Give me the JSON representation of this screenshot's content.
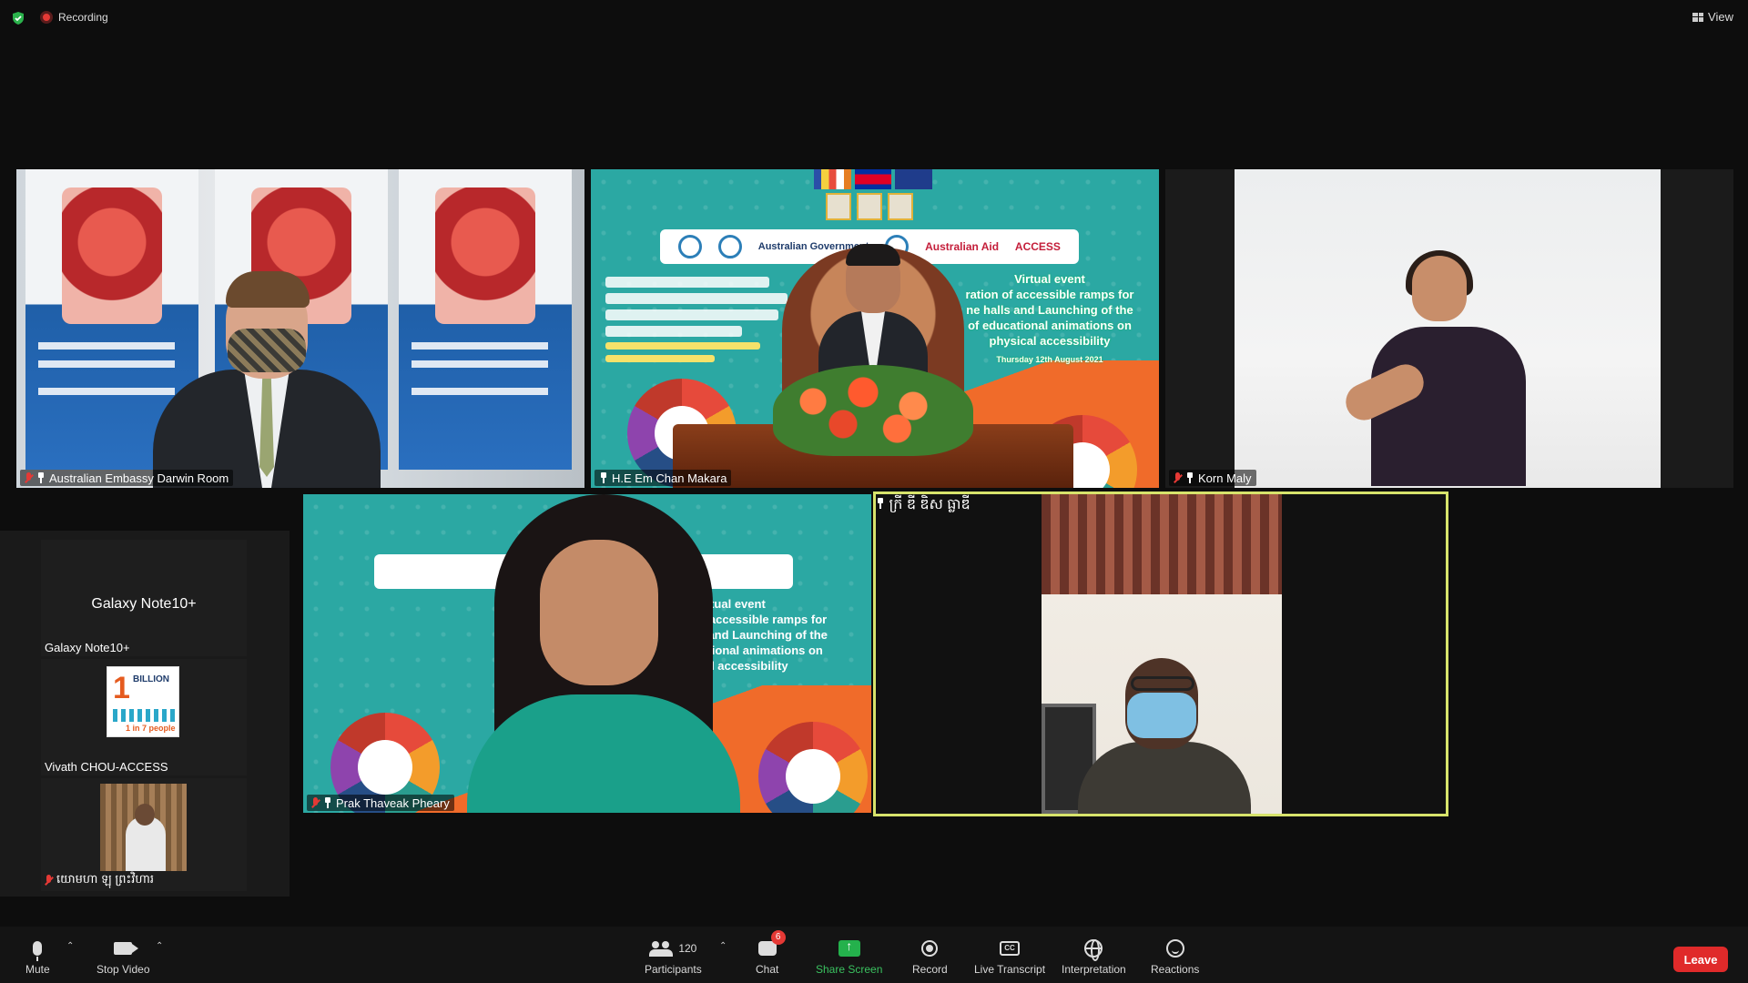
{
  "topbar": {
    "recording_label": "Recording",
    "view_label": "View"
  },
  "tiles": {
    "embassy": {
      "name": "Australian Embassy Darwin Room"
    },
    "minister": {
      "name": "H.E Em Chan Makara",
      "event_title": "Virtual event",
      "event_line1": "ration of accessible ramps for",
      "event_line2": "ne halls and Launching of the",
      "event_line3": "of educational animations on",
      "event_line4": "physical accessibility",
      "event_date": "Thursday 12th August 2021",
      "logo_gov": "Australian Government",
      "logo_aid": "Australian Aid",
      "logo_access": "ACCESS"
    },
    "interpreter": {
      "name": "Korn Maly"
    },
    "woman": {
      "name": "Prak Thaveak Pheary",
      "event_title": "Virtual event",
      "event_line1": "of accessible ramps for",
      "event_line2": "ls and Launching of the",
      "event_line3": "cational animations on",
      "event_line4": "ical accessibility"
    },
    "officer": {
      "name": "ក្រី ឌី ឌិស ធ្លាឌី"
    }
  },
  "strip": {
    "galaxy": {
      "title": "Galaxy Note10+",
      "name": "Galaxy Note10+"
    },
    "vivath": {
      "name": "Vivath CHOU-ACCESS",
      "poster_one": "1",
      "poster_billion": "BILLION",
      "poster_ratio": "1 in 7 people"
    },
    "monk": {
      "name": "យោមហា ឡុ ព្រះវិហារ"
    }
  },
  "toolbar": {
    "mute": "Mute",
    "stop_video": "Stop Video",
    "participants": "Participants",
    "participants_count": "120",
    "chat": "Chat",
    "chat_badge": "6",
    "share_screen": "Share Screen",
    "record": "Record",
    "live_transcript": "Live Transcript",
    "cc": "CC",
    "interpretation": "Interpretation",
    "reactions": "Reactions",
    "leave": "Leave"
  },
  "colors": {
    "accent_green": "#24b14c",
    "leave_red": "#e02a2a",
    "active_speaker_border": "#d7e36b",
    "teal_backdrop": "#2ba8a3"
  }
}
